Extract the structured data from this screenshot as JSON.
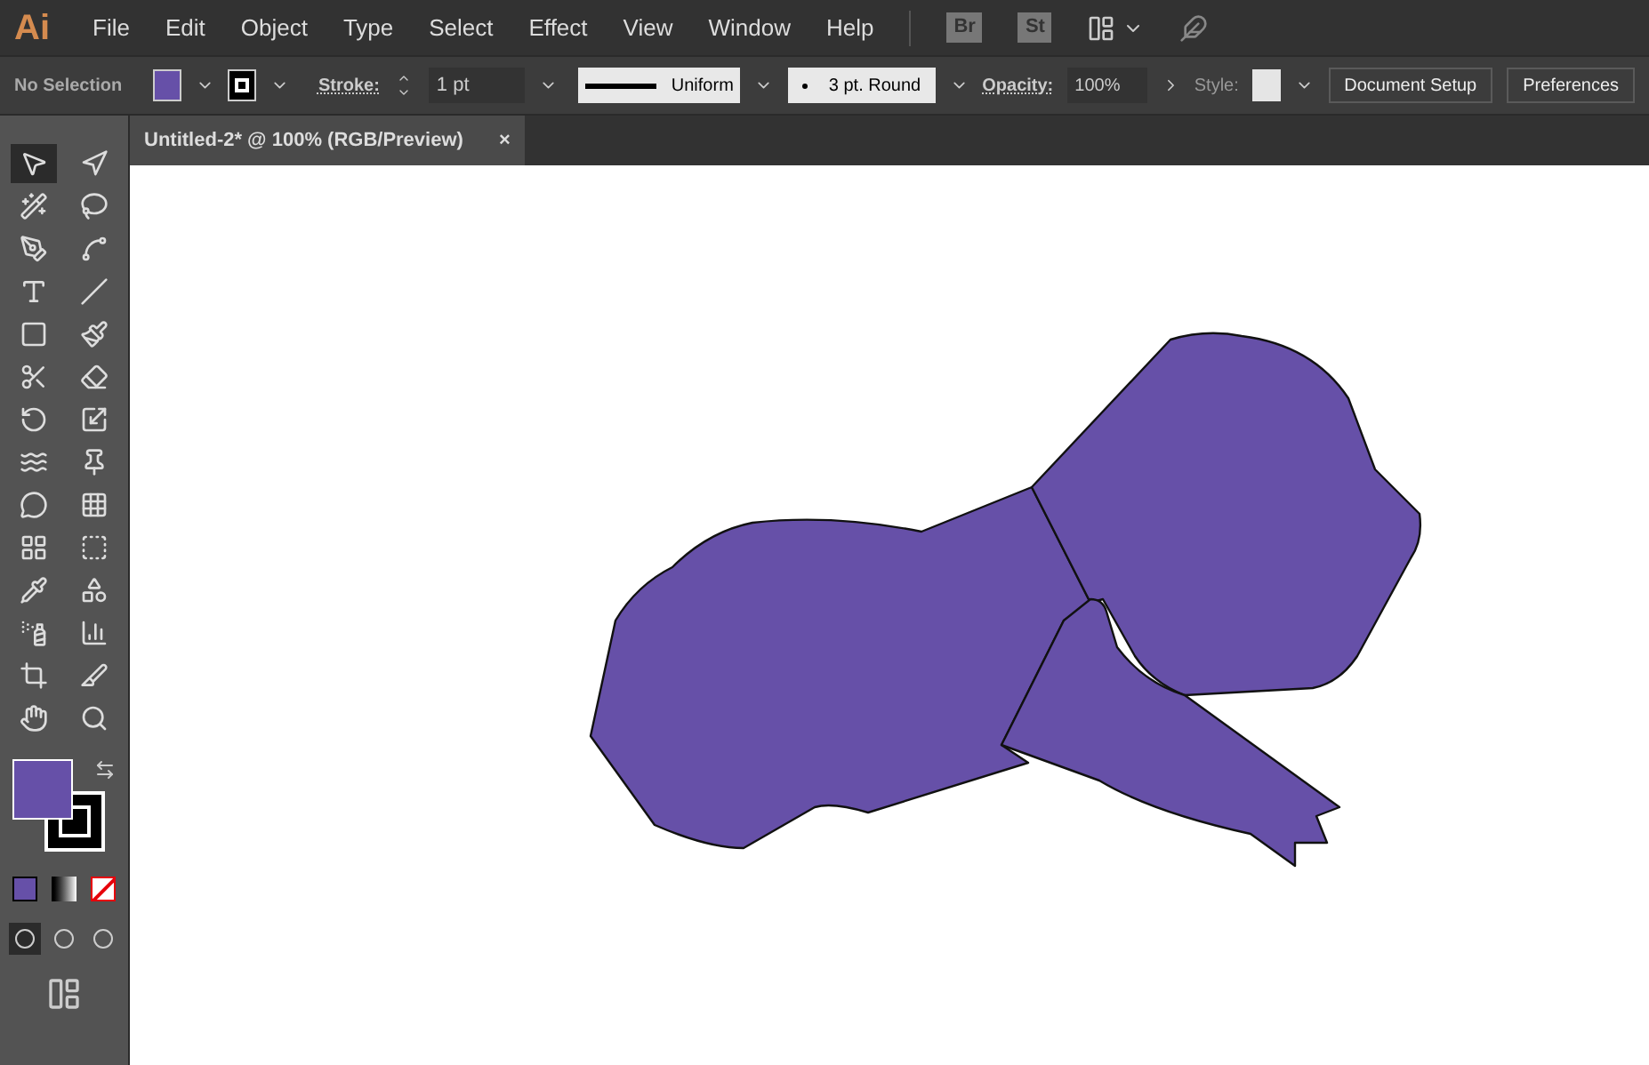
{
  "app": {
    "logo": "Ai"
  },
  "menu": [
    "File",
    "Edit",
    "Object",
    "Type",
    "Select",
    "Effect",
    "View",
    "Window",
    "Help"
  ],
  "menu_badges": [
    "Br",
    "St"
  ],
  "control_bar": {
    "selection": "No Selection",
    "stroke_label": "Stroke:",
    "stroke_weight": "1 pt",
    "profile": "Uniform",
    "brush": "3 pt. Round",
    "opacity_label": "Opacity:",
    "opacity": "100%",
    "style_label": "Style:",
    "buttons": [
      "Document Setup",
      "Preferences"
    ]
  },
  "document_tab": {
    "title": "Untitled-2* @ 100% (RGB/Preview)",
    "close": "×"
  },
  "tools": [
    {
      "kind": "selection",
      "selected": true
    },
    {
      "kind": "direct-selection",
      "selected": false
    },
    {
      "kind": "magic-wand",
      "selected": false
    },
    {
      "kind": "lasso",
      "selected": false
    },
    {
      "kind": "pen",
      "selected": false
    },
    {
      "kind": "curvature",
      "selected": false
    },
    {
      "kind": "type",
      "selected": false
    },
    {
      "kind": "line",
      "selected": false
    },
    {
      "kind": "rectangle",
      "selected": false
    },
    {
      "kind": "paintbrush",
      "selected": false
    },
    {
      "kind": "shaper",
      "selected": false
    },
    {
      "kind": "eraser",
      "selected": false
    },
    {
      "kind": "rotate",
      "selected": false
    },
    {
      "kind": "scale",
      "selected": false
    },
    {
      "kind": "warp",
      "selected": false
    },
    {
      "kind": "pin",
      "selected": false
    },
    {
      "kind": "shape-builder",
      "selected": false
    },
    {
      "kind": "perspective",
      "selected": false
    },
    {
      "kind": "mesh",
      "selected": false
    },
    {
      "kind": "gradient",
      "selected": false
    },
    {
      "kind": "eyedropper",
      "selected": false
    },
    {
      "kind": "blend",
      "selected": false
    },
    {
      "kind": "symbol-sprayer",
      "selected": false
    },
    {
      "kind": "graph",
      "selected": false
    },
    {
      "kind": "artboard",
      "selected": false
    },
    {
      "kind": "slice",
      "selected": false
    },
    {
      "kind": "hand",
      "selected": false
    },
    {
      "kind": "zoom",
      "selected": false
    }
  ],
  "draw_modes": [
    {
      "selected": true
    },
    {
      "selected": false
    },
    {
      "selected": false
    }
  ]
}
